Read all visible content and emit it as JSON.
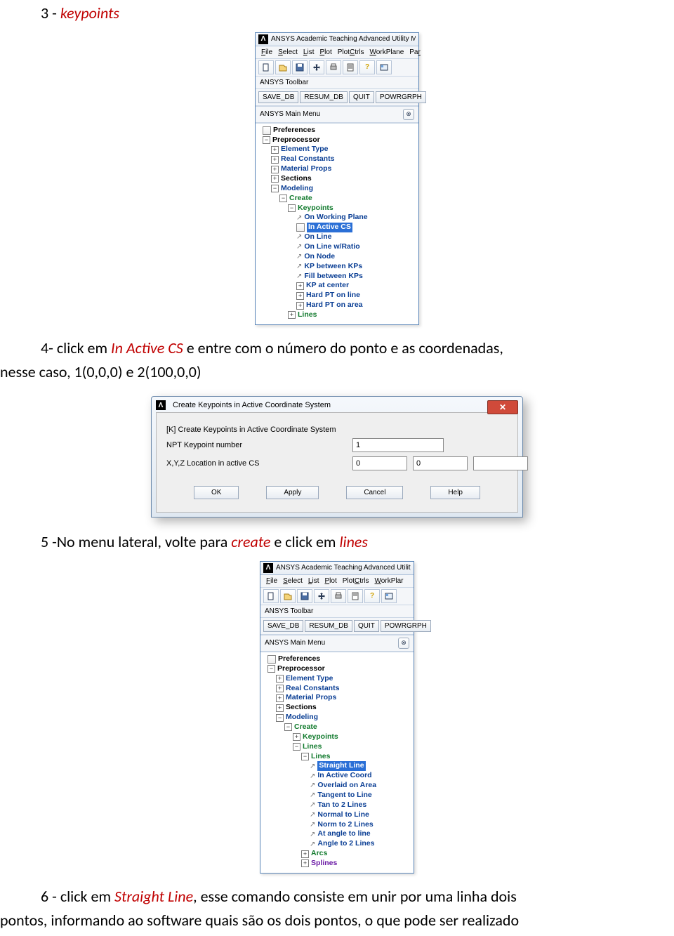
{
  "doc": {
    "step3_number": "3 - ",
    "step3_kw": "keypoints",
    "step4_pre": "4- click em ",
    "step4_kw": "In Active CS",
    "step4_post_a": " e entre com o número do ponto e as coordenadas,",
    "step4_post_b": "nesse caso, 1(0,0,0) e 2(100,0,0)",
    "step5_pre": "5 -No menu lateral, volte para ",
    "step5_kw1": "create",
    "step5_mid": " e click em ",
    "step5_kw2": "lines",
    "step6_pre": "6 - click em ",
    "step6_kw": "Straight Line",
    "step6_post_a": ", esse comando consiste em unir por uma linha dois",
    "step6_post_b": "pontos, informando ao software quais são os dois pontos, o que pode ser realizado"
  },
  "app_title": "ANSYS Academic Teaching Advanced Utility Menu",
  "app_title2": "ANSYS Academic Teaching Advanced Utility M",
  "menu": {
    "file": "File",
    "select": "Select",
    "list": "List",
    "plot": "Plot",
    "plotctrls": "PlotCtrls",
    "workplane": "WorkPlane",
    "par": "Par",
    "workplar": "WorkPlar"
  },
  "toolbar_label": "ANSYS Toolbar",
  "btns": {
    "save": "SAVE_DB",
    "resum": "RESUM_DB",
    "quit": "QUIT",
    "powr": "POWRGRPH"
  },
  "mainmenu": "ANSYS Main Menu",
  "tree1": {
    "preferences": "Preferences",
    "preprocessor": "Preprocessor",
    "eltype": "Element Type",
    "realconst": "Real Constants",
    "matprops": "Material Props",
    "sections": "Sections",
    "modeling": "Modeling",
    "create": "Create",
    "keypoints": "Keypoints",
    "onwp": "On Working Plane",
    "inactive": "In Active CS",
    "online": "On Line",
    "onlineratio": "On Line w/Ratio",
    "onnode": "On Node",
    "kpbetween": "KP between KPs",
    "fillbetween": "Fill between KPs",
    "kpcenter": "KP at center",
    "hardptline": "Hard PT on line",
    "hardptarea": "Hard PT on area",
    "lines": "Lines"
  },
  "tree2": {
    "preferences": "Preferences",
    "preprocessor": "Preprocessor",
    "eltype": "Element Type",
    "realconst": "Real Constants",
    "matprops": "Material Props",
    "sections": "Sections",
    "modeling": "Modeling",
    "create": "Create",
    "keypoints": "Keypoints",
    "lines_parent": "Lines",
    "lines": "Lines",
    "straight": "Straight Line",
    "inactivecoord": "In Active Coord",
    "overlaid": "Overlaid on Area",
    "tangent": "Tangent to Line",
    "tanto2": "Tan to 2 Lines",
    "normal": "Normal to Line",
    "normto2": "Norm to 2 Lines",
    "atangle": "At angle to line",
    "angleto2": "Angle to 2 Lines",
    "arcs": "Arcs",
    "splines": "Splines"
  },
  "dialog": {
    "title": "Create Keypoints in Active Coordinate System",
    "heading": "[K]  Create Keypoints in Active Coordinate System",
    "npt": "NPT   Keypoint number",
    "xyz": "X,Y,Z  Location in active CS",
    "npt_val": "1",
    "x_val": "0",
    "y_val": "0",
    "z_val": "",
    "ok": "OK",
    "apply": "Apply",
    "cancel": "Cancel",
    "help": "Help"
  }
}
